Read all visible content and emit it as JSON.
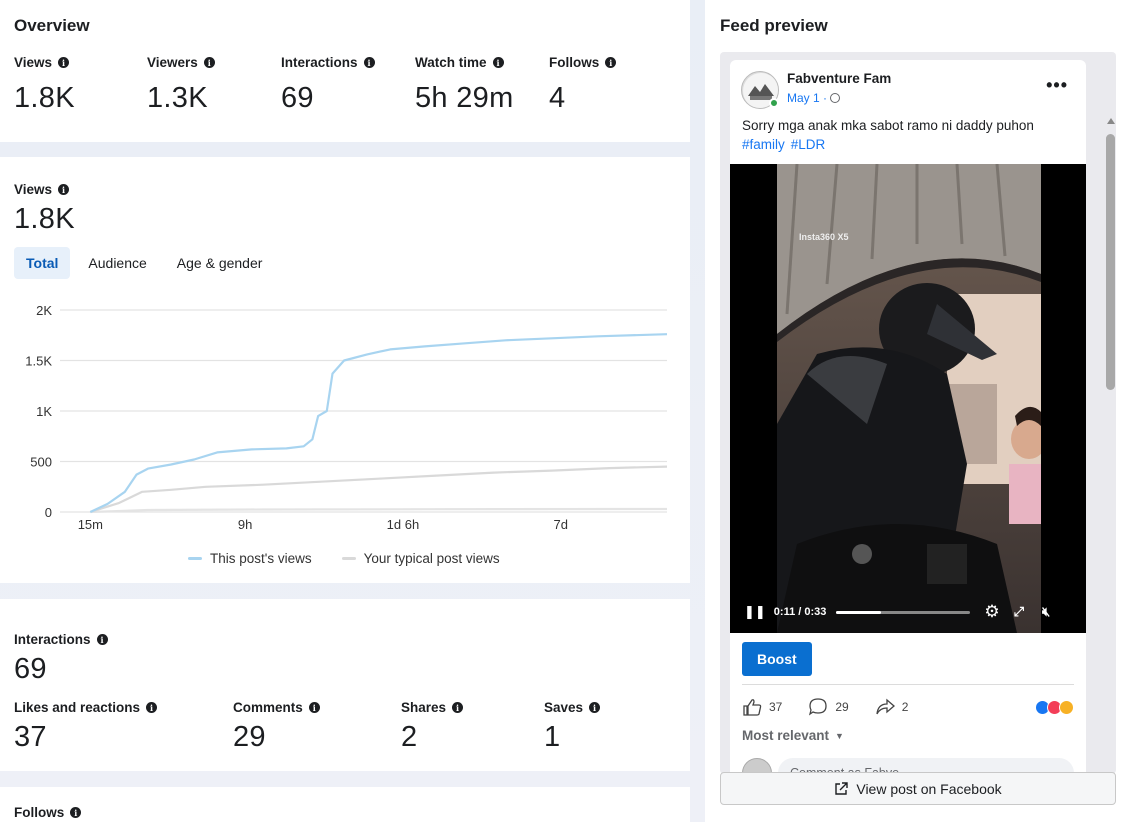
{
  "overview": {
    "title": "Overview",
    "metrics": [
      {
        "label": "Views",
        "value": "1.8K"
      },
      {
        "label": "Viewers",
        "value": "1.3K"
      },
      {
        "label": "Interactions",
        "value": "69"
      },
      {
        "label": "Watch time",
        "value": "5h 29m"
      },
      {
        "label": "Follows",
        "value": "4"
      }
    ]
  },
  "views_section": {
    "label": "Views",
    "value": "1.8K",
    "tabs": [
      {
        "label": "Total",
        "active": true
      },
      {
        "label": "Audience",
        "active": false
      },
      {
        "label": "Age & gender",
        "active": false
      }
    ],
    "legend": {
      "series_a": "This post's views",
      "series_b": "Your typical post views"
    }
  },
  "chart_data": {
    "type": "line",
    "title": "",
    "xlabel": "",
    "ylabel": "",
    "ylim": [
      0,
      2000
    ],
    "yticks": [
      "0",
      "500",
      "1K",
      "1.5K",
      "2K"
    ],
    "xticks": [
      "15m",
      "9h",
      "1d 6h",
      "7d"
    ],
    "grid": true,
    "legend_position": "bottom",
    "series": [
      {
        "name": "This post's views",
        "color": "#a8d4f0",
        "points": [
          [
            0.0,
            0
          ],
          [
            0.03,
            80
          ],
          [
            0.06,
            200
          ],
          [
            0.08,
            370
          ],
          [
            0.1,
            430
          ],
          [
            0.14,
            470
          ],
          [
            0.18,
            520
          ],
          [
            0.22,
            590
          ],
          [
            0.28,
            620
          ],
          [
            0.34,
            630
          ],
          [
            0.37,
            650
          ],
          [
            0.385,
            720
          ],
          [
            0.395,
            950
          ],
          [
            0.41,
            1000
          ],
          [
            0.42,
            1370
          ],
          [
            0.44,
            1500
          ],
          [
            0.48,
            1560
          ],
          [
            0.52,
            1610
          ],
          [
            0.58,
            1640
          ],
          [
            0.65,
            1670
          ],
          [
            0.72,
            1700
          ],
          [
            0.8,
            1720
          ],
          [
            0.88,
            1740
          ],
          [
            1.0,
            1760
          ]
        ]
      },
      {
        "name": "Your typical post views",
        "color": "#d9d9d9",
        "points": [
          [
            0.0,
            0
          ],
          [
            0.05,
            90
          ],
          [
            0.09,
            200
          ],
          [
            0.14,
            220
          ],
          [
            0.2,
            250
          ],
          [
            0.3,
            270
          ],
          [
            0.4,
            300
          ],
          [
            0.5,
            330
          ],
          [
            0.6,
            360
          ],
          [
            0.7,
            390
          ],
          [
            0.8,
            410
          ],
          [
            0.9,
            435
          ],
          [
            1.0,
            450
          ]
        ]
      },
      {
        "name": "",
        "color": "#e4e4e4",
        "points": [
          [
            0.0,
            0
          ],
          [
            0.1,
            20
          ],
          [
            0.3,
            25
          ],
          [
            0.6,
            28
          ],
          [
            1.0,
            30
          ]
        ]
      }
    ]
  },
  "interactions": {
    "label": "Interactions",
    "value": "69",
    "breakdown": [
      {
        "label": "Likes and reactions",
        "value": "37"
      },
      {
        "label": "Comments",
        "value": "29"
      },
      {
        "label": "Shares",
        "value": "2"
      },
      {
        "label": "Saves",
        "value": "1"
      }
    ]
  },
  "follows": {
    "label": "Follows"
  },
  "feed_preview": {
    "title": "Feed preview",
    "page_name": "Fabventure Fam",
    "date": "May 1 ·",
    "caption": "Sorry mga anak mka sabot ramo ni daddy puhon",
    "hashtags": [
      "#family",
      "#LDR"
    ],
    "video_watermark": "Insta360 X5",
    "video_time": "0:11 / 0:33",
    "video_progress": 0.333,
    "boost_label": "Boost",
    "likes": "37",
    "comments": "29",
    "shares": "2",
    "most_relevant": "Most relevant",
    "comment_placeholder": "Comment as Fabve...",
    "view_on_facebook": "View post on Facebook",
    "accent_color": "#1877f2"
  }
}
